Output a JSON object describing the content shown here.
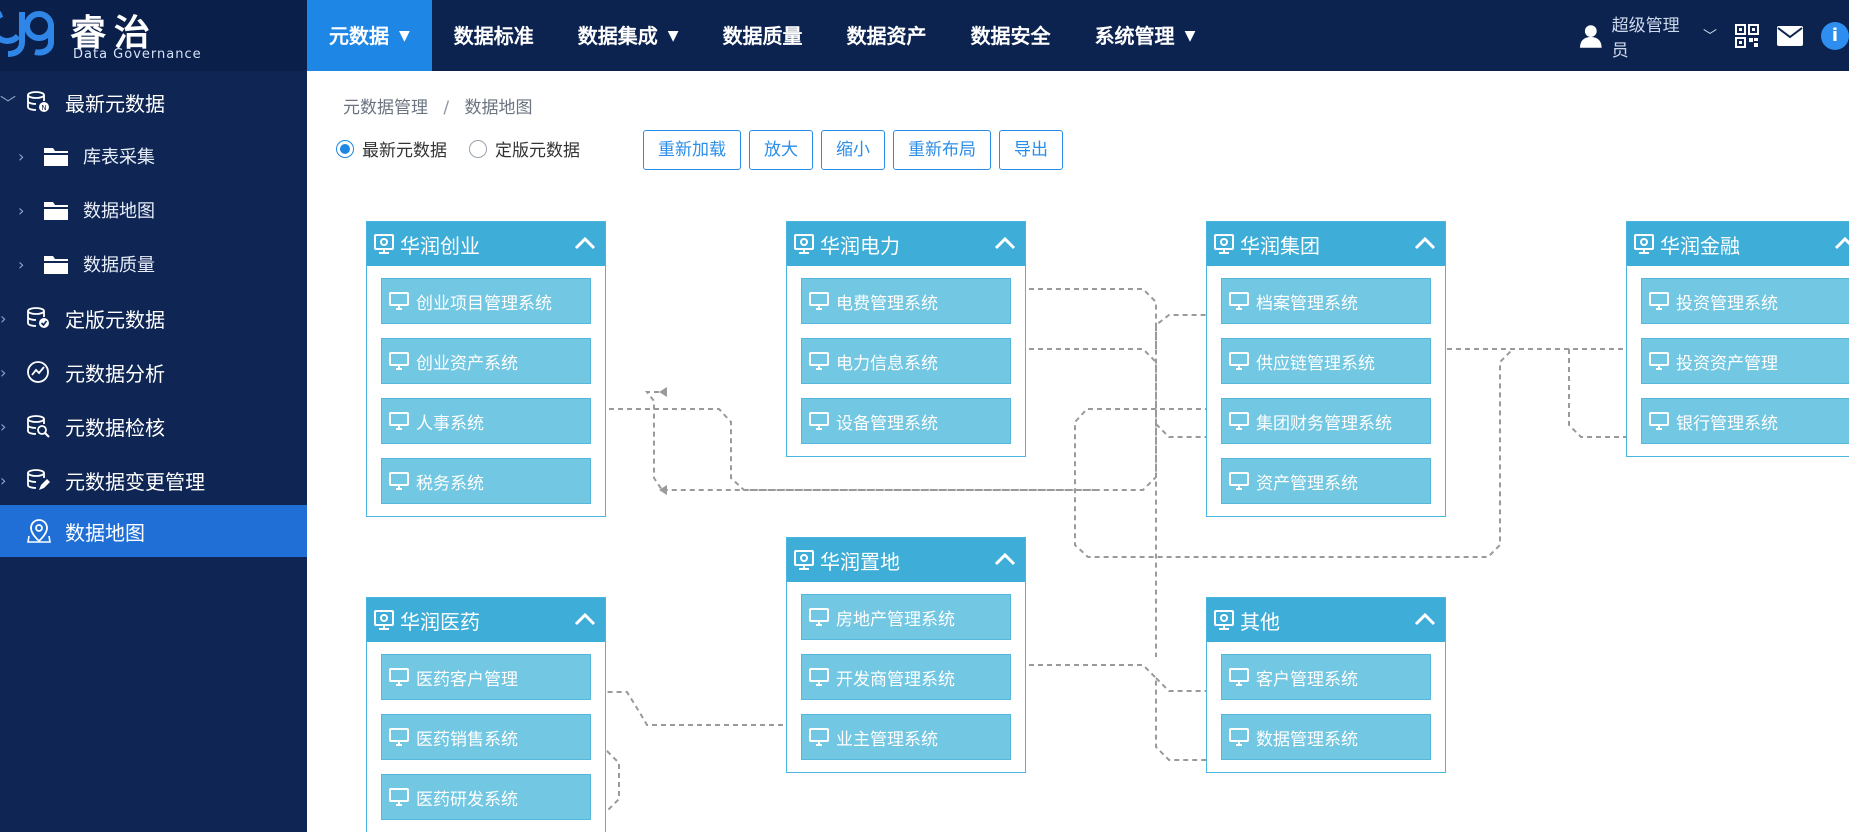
{
  "brand": {
    "name": "睿治",
    "subtitle": "Data Governance"
  },
  "topnav": [
    {
      "label": "元数据",
      "caret": "▼",
      "active": true
    },
    {
      "label": "数据标准",
      "caret": "",
      "active": false
    },
    {
      "label": "数据集成",
      "caret": "▼",
      "active": false
    },
    {
      "label": "数据质量",
      "caret": "",
      "active": false
    },
    {
      "label": "数据资产",
      "caret": "",
      "active": false
    },
    {
      "label": "数据安全",
      "caret": "",
      "active": false
    },
    {
      "label": "系统管理",
      "caret": "▼",
      "active": false
    }
  ],
  "user": {
    "name": "超级管理员",
    "chevron": "﹀"
  },
  "sidebar": [
    {
      "label": "最新元数据",
      "level": 0,
      "arrow": "﹀",
      "icon": "database-new-icon"
    },
    {
      "label": "库表采集",
      "level": 1,
      "arrow": "›",
      "icon": "folder-icon"
    },
    {
      "label": "数据地图",
      "level": 1,
      "arrow": "›",
      "icon": "folder-icon"
    },
    {
      "label": "数据质量",
      "level": 1,
      "arrow": "›",
      "icon": "folder-icon"
    },
    {
      "label": "定版元数据",
      "level": 0,
      "arrow": "›",
      "icon": "database-check-icon"
    },
    {
      "label": "元数据分析",
      "level": 0,
      "arrow": "›",
      "icon": "analysis-icon"
    },
    {
      "label": "元数据检核",
      "level": 0,
      "arrow": "›",
      "icon": "database-search-icon"
    },
    {
      "label": "元数据变更管理",
      "level": 0,
      "arrow": "›",
      "icon": "database-edit-icon"
    },
    {
      "label": "数据地图",
      "level": 0,
      "arrow": "",
      "icon": "map-pin-icon",
      "active": true
    }
  ],
  "breadcrumb": {
    "parent": "元数据管理",
    "separator": "/",
    "current": "数据地图"
  },
  "radios": [
    {
      "label": "最新元数据",
      "checked": true
    },
    {
      "label": "定版元数据",
      "checked": false
    }
  ],
  "buttons": [
    "重新加载",
    "放大",
    "缩小",
    "重新布局",
    "导出"
  ],
  "groups": [
    {
      "title": "华润创业",
      "systems": [
        "创业项目管理系统",
        "创业资产系统",
        "人事系统",
        "税务系统"
      ]
    },
    {
      "title": "华润电力",
      "systems": [
        "电费管理系统",
        "电力信息系统",
        "设备管理系统"
      ]
    },
    {
      "title": "华润集团",
      "systems": [
        "档案管理系统",
        "供应链管理系统",
        "集团财务管理系统",
        "资产管理系统"
      ]
    },
    {
      "title": "华润金融",
      "systems": [
        "投资管理系统",
        "投资资产管理",
        "银行管理系统"
      ]
    },
    {
      "title": "华润置地",
      "systems": [
        "房地产管理系统",
        "开发商管理系统",
        "业主管理系统"
      ]
    },
    {
      "title": "华润医药",
      "systems": [
        "医药客户管理",
        "医药销售系统",
        "医药研发系统"
      ]
    },
    {
      "title": "其他",
      "systems": [
        "客户管理系统",
        "数据管理系统"
      ]
    }
  ],
  "colors": {
    "nav_bg": "#0c2350",
    "nav_active": "#1e87e5",
    "sidebar_active": "#1f6fd6",
    "group_header": "#3eaed8",
    "system_node": "#72c7e2",
    "link_line": "#9a9a9a"
  }
}
